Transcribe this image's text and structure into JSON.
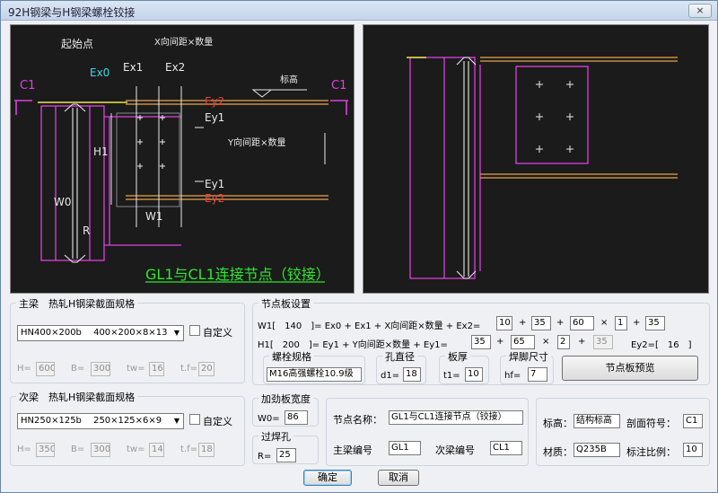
{
  "window": {
    "title": "92H钢梁与H钢梁螺栓铰接",
    "close_icon": "×"
  },
  "drawing": {
    "start_point": "起始点",
    "x_spacing_count": "X向间距×数量",
    "y_spacing_count": "Y向间距×数量",
    "elevation": "标高",
    "section_symbol": "C1",
    "ex0": "Ex0",
    "ex1": "Ex1",
    "ex2": "Ex2",
    "ey1": "Ey1",
    "ey2": "Ey2",
    "h1": "H1",
    "w0": "W0",
    "w1": "W1",
    "r": "R",
    "node_title": "GL1与CL1连接节点（铰接）"
  },
  "main_beam": {
    "group_title": "主梁　热轧H钢梁截面规格",
    "section": "HN400×200b　 400×200×8×13",
    "custom_label": "自定义",
    "h_label": "H=",
    "h": "600",
    "b_label": "B=",
    "b": "300",
    "tw_label": "tw=",
    "tw": "16",
    "tf_label": "t.f=",
    "tf": "20"
  },
  "sub_beam": {
    "group_title": "次梁　热轧H钢梁截面规格",
    "section": "HN250×125b　 250×125×6×9",
    "custom_label": "自定义",
    "h_label": "H=",
    "h": "350",
    "b_label": "B=",
    "b": "300",
    "tw_label": "tw=",
    "tw": "14",
    "tf_label": "t.f=",
    "tf": "18"
  },
  "plate": {
    "group_title": "节点板设置",
    "w1_label": "W1[　140　]= Ex0 + Ex1 + X向间距×数量 + Ex2=",
    "h1_label": "H1[　200　]= Ey1 + Y向间距×数量 + Ey1=",
    "w1_ex0": "10",
    "w1_ex1": "35",
    "w1_xsp": "60",
    "w1_xn": "1",
    "w1_ex2": "35",
    "h1_ey1": "35",
    "h1_ysp": "65",
    "h1_yn": "2",
    "h1_ey1b": "35",
    "ey2_label": "Ey2=[　16　]",
    "op_plus": "+",
    "op_times": "×",
    "bolt_group": "螺栓规格",
    "bolt_spec": "M16高强螺栓10.9级",
    "hole_group": "孔直径",
    "hole_label": "d1=",
    "hole": "18",
    "thick_group": "板厚",
    "thick_label": "t1=",
    "thick": "10",
    "weld_group": "焊脚尺寸",
    "weld_label": "hf=",
    "weld": "7",
    "preview_button": "节点板预览"
  },
  "stiffener": {
    "group_title": "加劲板宽度",
    "label": "W0=",
    "value": "86"
  },
  "weld_hole": {
    "group_title": "过焊孔",
    "label": "R=",
    "value": "25"
  },
  "node": {
    "name_label": "节点名称：",
    "name": "GL1与CL1连接节点（铰接）",
    "main_label": "主梁编号",
    "main": "GL1",
    "sub_label": "次梁编号",
    "sub": "CL1"
  },
  "annotation": {
    "elev_label": "标高：",
    "elev": "结构标高",
    "section_label": "剖面符号：",
    "section": "C1",
    "material_label": "材质：",
    "material": "Q235B",
    "scale_label": "标注比例：",
    "scale": "10"
  },
  "buttons": {
    "ok": "确定",
    "cancel": "取消"
  }
}
